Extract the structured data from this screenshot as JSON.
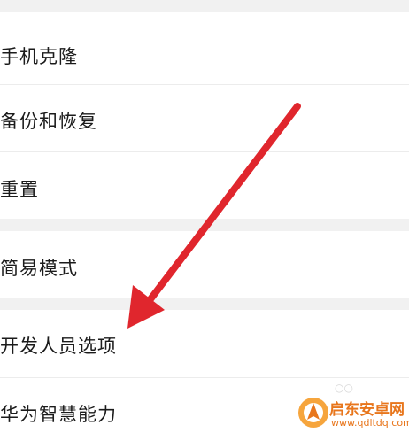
{
  "settings_list": {
    "items": [
      {
        "label": "手机克隆"
      },
      {
        "label": "备份和恢复"
      },
      {
        "label": "重置"
      },
      {
        "label": "简易模式"
      },
      {
        "label": "开发人员选项"
      },
      {
        "label": "华为智慧能力"
      }
    ]
  },
  "annotation": {
    "arrow_color": "#e0262d"
  },
  "watermark": {
    "name": "启东安卓网",
    "url": "www.qdltdq.com",
    "brand_color": "#e8761c"
  }
}
